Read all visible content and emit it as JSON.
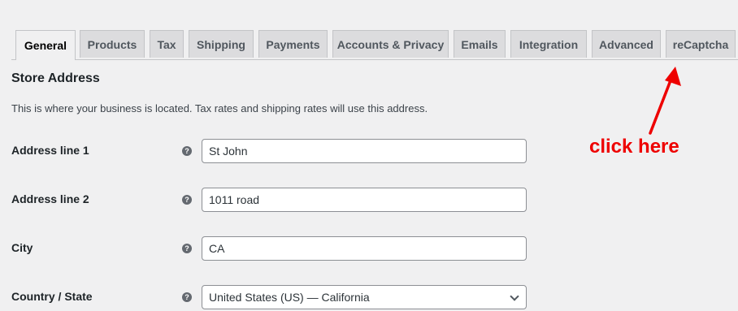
{
  "tabs": [
    {
      "label": "General",
      "active": true
    },
    {
      "label": "Products"
    },
    {
      "label": "Tax"
    },
    {
      "label": "Shipping"
    },
    {
      "label": "Payments"
    },
    {
      "label": "Accounts & Privacy"
    },
    {
      "label": "Emails"
    },
    {
      "label": "Integration"
    },
    {
      "label": "Advanced"
    },
    {
      "label": "reCaptcha"
    }
  ],
  "section": {
    "title": "Store Address",
    "description": "This is where your business is located. Tax rates and shipping rates will use this address."
  },
  "fields": {
    "address1": {
      "label": "Address line 1",
      "value": "St John"
    },
    "address2": {
      "label": "Address line 2",
      "value": "1011 road"
    },
    "city": {
      "label": "City",
      "value": "CA"
    },
    "country": {
      "label": "Country / State",
      "value": "United States (US) — California"
    }
  },
  "help_glyph": "?",
  "annotation": {
    "text": "click here",
    "color": "#ee0000"
  },
  "icons": {
    "help": "help-icon",
    "dropdown": "chevron-down-icon",
    "arrow": "annotation-arrow-icon"
  }
}
